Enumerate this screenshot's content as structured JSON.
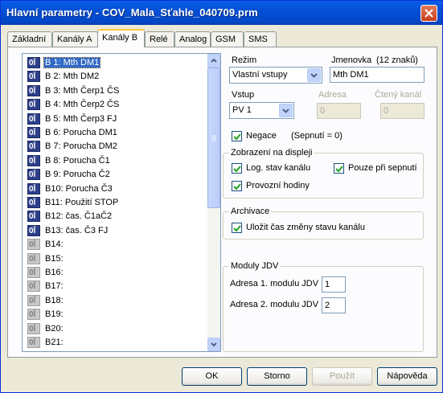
{
  "window": {
    "title": "Hlavní parametry - COV_Mala_Sťahle_040709.prm"
  },
  "tabs": [
    {
      "label": "Základní"
    },
    {
      "label": "Kanály A"
    },
    {
      "label": "Kanály B"
    },
    {
      "label": "Relé"
    },
    {
      "label": "Analog"
    },
    {
      "label": "GSM"
    },
    {
      "label": "SMS"
    }
  ],
  "active_tab": "Kanály B",
  "channels": [
    {
      "icon": "0Ī",
      "label": "B 1: Mth DM1",
      "active": true,
      "selected": true
    },
    {
      "icon": "0Ī",
      "label": "B 2: Mth DM2",
      "active": true
    },
    {
      "icon": "0Ī",
      "label": "B 3: Mth Čerp1 ČS",
      "active": true
    },
    {
      "icon": "0Ī",
      "label": "B 4: Mth Čerp2 ČS",
      "active": true
    },
    {
      "icon": "0Ī",
      "label": "B 5: Mth Čerp3 FJ",
      "active": true
    },
    {
      "icon": "0Ī",
      "label": "B 6: Porucha DM1",
      "active": true
    },
    {
      "icon": "0Ī",
      "label": "B 7: Porucha DM2",
      "active": true
    },
    {
      "icon": "0Ī",
      "label": "B 8: Porucha Č1",
      "active": true
    },
    {
      "icon": "0Ī",
      "label": "B 9: Porucha Č2",
      "active": true
    },
    {
      "icon": "0Ī",
      "label": "B10: Porucha Č3",
      "active": true
    },
    {
      "icon": "0Ī",
      "label": "B11: Použití STOP",
      "active": true
    },
    {
      "icon": "0Ī",
      "label": "B12: čas. Č1aČ2",
      "active": true
    },
    {
      "icon": "0Ī",
      "label": "B13: čas. Č3 FJ",
      "active": true
    },
    {
      "icon": "0Ī",
      "label": "B14:",
      "active": false
    },
    {
      "icon": "0Ī",
      "label": "B15:",
      "active": false
    },
    {
      "icon": "0Ī",
      "label": "B16:",
      "active": false
    },
    {
      "icon": "0Ī",
      "label": "B17:",
      "active": false
    },
    {
      "icon": "0Ī",
      "label": "B18:",
      "active": false
    },
    {
      "icon": "0Ī",
      "label": "B19:",
      "active": false
    },
    {
      "icon": "0Ī",
      "label": "B20:",
      "active": false
    },
    {
      "icon": "0Ī",
      "label": "B21:",
      "active": false
    }
  ],
  "form": {
    "rezim_label": "Režim",
    "rezim_value": "Vlastní vstupy",
    "jmenovka_label": "Jmenovka",
    "jmenovka_hint": "(12 znaků)",
    "jmenovka_value": "Mth DM1",
    "vstup_label": "Vstup",
    "vstup_value": "PV 1",
    "adresa_label": "Adresa",
    "adresa_value": "0",
    "cteny_kanal_label": "Čtený kanál",
    "cteny_kanal_value": "0",
    "negace_label": "Negace",
    "negace_checked": true,
    "negace_note": "(Sepnutí = 0)"
  },
  "zobrazeni": {
    "title": "Zobrazení na displeji",
    "log_stav_label": "Log. stav kanálu",
    "log_stav_checked": true,
    "pouze_label": "Pouze při sepnutí",
    "pouze_checked": true,
    "provozni_label": "Provozní hodiny",
    "provozni_checked": true
  },
  "archivace": {
    "title": "Archivace",
    "ulozit_label": "Uložit čas změny stavu kanálu",
    "ulozit_checked": true
  },
  "moduly": {
    "title": "Moduly JDV",
    "adresa1_label": "Adresa 1. modulu JDV",
    "adresa1_value": "1",
    "adresa2_label": "Adresa 2. modulu JDV",
    "adresa2_value": "2"
  },
  "buttons": {
    "ok": "OK",
    "storno": "Storno",
    "pouzit": "Použít",
    "napoveda": "Nápověda"
  },
  "colors": {
    "titlebar": "#0450d6",
    "selection": "#316ac5",
    "active_icon": "#2c3f88",
    "tab_highlight": "#ffc83c"
  }
}
